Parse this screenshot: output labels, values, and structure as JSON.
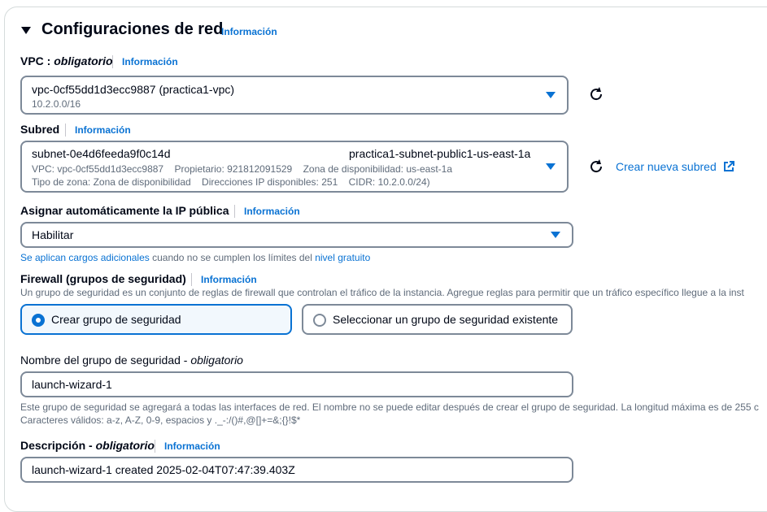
{
  "section": {
    "title": "Configuraciones de red",
    "info": "Información"
  },
  "vpc": {
    "label_main": "VPC",
    "label_sep": " : ",
    "label_required": "obligatorio",
    "info": "Información",
    "selected": "vpc-0cf55dd1d3ecc9887 (practica1-vpc)",
    "cidr": "10.2.0.0/16"
  },
  "subnet": {
    "label": "Subred",
    "info": "Información",
    "id": "subnet-0e4d6feeda9f0c14d",
    "name": "practica1-subnet-public1-us-east-1a",
    "line2": "VPC: vpc-0cf55dd1d3ecc9887    Propietario: 921812091529    Zona de disponibilidad: us-east-1a",
    "line3": "Tipo de zona: Zona de disponibilidad    Direcciones IP disponibles: 251    CIDR: 10.2.0.0/24)",
    "create_link": "Crear nueva subred"
  },
  "public_ip": {
    "label": "Asignar automáticamente la IP pública",
    "info": "Información",
    "selected": "Habilitar",
    "note_link1": "Se aplican cargos adicionales",
    "note_mid": " cuando no se cumplen los límites del ",
    "note_link2": "nivel gratuito"
  },
  "firewall": {
    "label": "Firewall (grupos de seguridad)",
    "info": "Información",
    "description": "Un grupo de seguridad es un conjunto de reglas de firewall que controlan el tráfico de la instancia. Agregue reglas para permitir que un tráfico específico llegue a la inst",
    "option_create": "Crear grupo de seguridad",
    "option_existing": "Seleccionar un grupo de seguridad existente",
    "selected": "create"
  },
  "sg_name": {
    "label_main": "Nombre del grupo de seguridad",
    "label_sep": " - ",
    "label_required": "obligatorio",
    "value": "launch-wizard-1",
    "help1": "Este grupo de seguridad se agregará a todas las interfaces de red. El nombre no se puede editar después de crear el grupo de seguridad. La longitud máxima es de 255 c",
    "help2": "Caracteres válidos: a-z, A-Z, 0-9, espacios y ._-:/()#,@[]+=&;{}!$*"
  },
  "sg_desc": {
    "label_main": "Descripción",
    "label_sep": " - ",
    "label_required": "obligatorio",
    "info": "Información",
    "value": "launch-wizard-1 created 2025-02-04T07:47:39.403Z"
  },
  "colors": {
    "accent": "#0972d3",
    "border": "#7d8998",
    "text": "#000716",
    "muted": "#5f6b7a"
  }
}
